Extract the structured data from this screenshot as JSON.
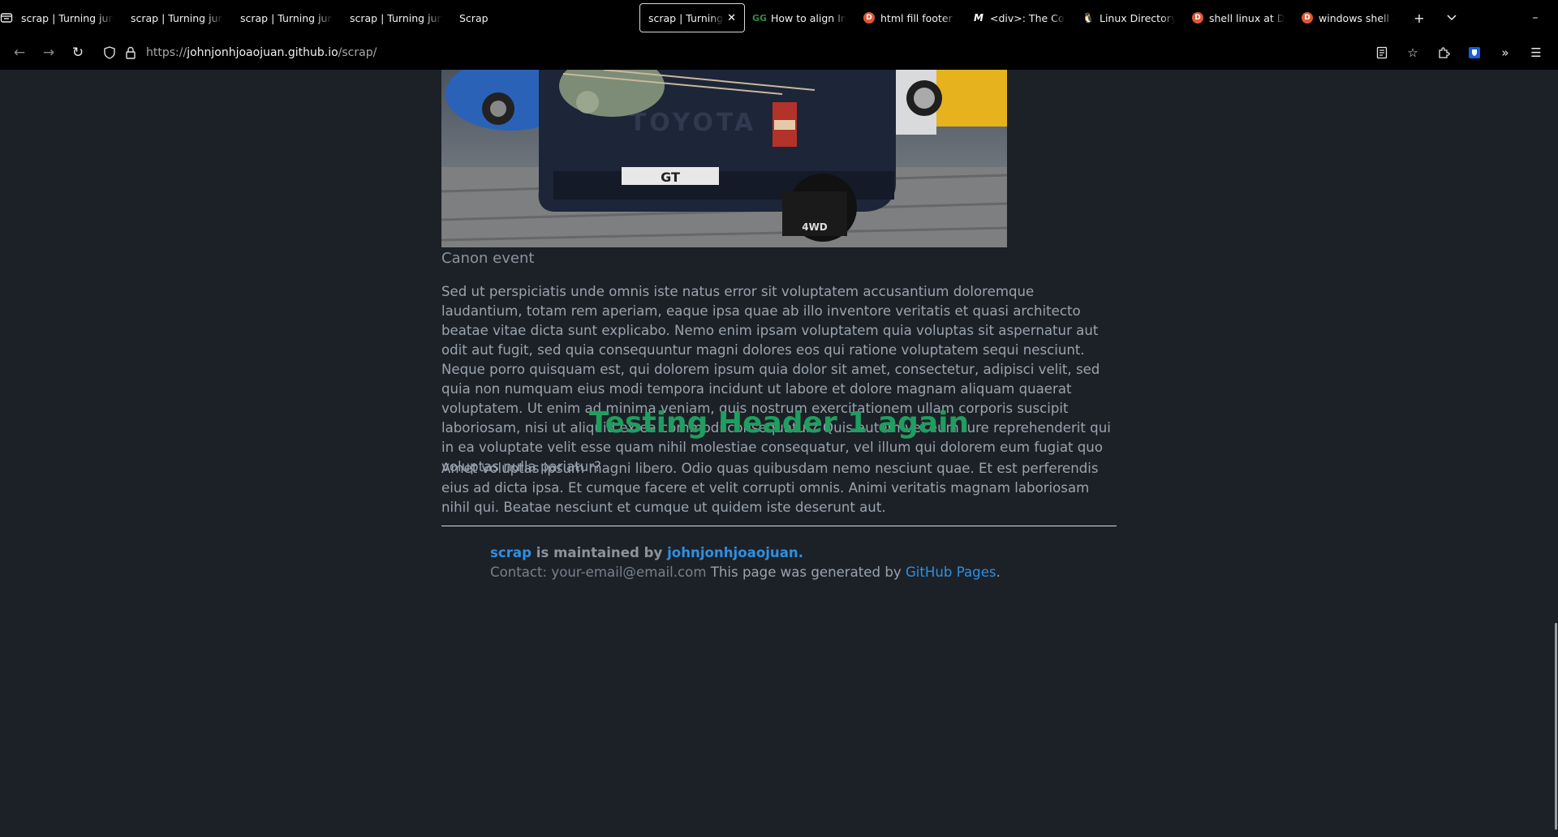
{
  "browser": {
    "tabs": [
      {
        "label": "scrap | Turning junk into art",
        "favicon": "none"
      },
      {
        "label": "scrap | Turning junk into art",
        "favicon": "none"
      },
      {
        "label": "scrap | Turning junk into art",
        "favicon": "none"
      },
      {
        "label": "scrap | Turning junk into art",
        "favicon": "none"
      },
      {
        "label": "Scrap",
        "favicon": "none"
      },
      {
        "label": "scrap | Turning junk into art",
        "favicon": "none",
        "active": true
      },
      {
        "label": "How to align Images",
        "favicon": "geeksforgeeks-icon"
      },
      {
        "label": "html fill footer at bottom",
        "favicon": "duckduckgo-icon"
      },
      {
        "label": "<div>: The Content Division",
        "favicon": "mdn-icon"
      },
      {
        "label": "Linux Directory Structure",
        "favicon": "linux-icon"
      },
      {
        "label": "shell linux at DuckDuckGo",
        "favicon": "duckduckgo-icon"
      },
      {
        "label": "windows shell at DuckDuckGo",
        "favicon": "duckduckgo-icon"
      }
    ],
    "url": {
      "scheme": "https://",
      "host": "johnjonhjoaojuan.github.io",
      "path": "/scrap/"
    }
  },
  "page": {
    "caption": "Canon event",
    "paragraph1": "Sed ut perspiciatis unde omnis iste natus error sit voluptatem accusantium doloremque laudantium, totam rem aperiam, eaque ipsa quae ab illo inventore veritatis et quasi architecto beatae vitae dicta sunt explicabo. Nemo enim ipsam voluptatem quia voluptas sit aspernatur aut odit aut fugit, sed quia consequuntur magni dolores eos qui ratione voluptatem sequi nesciunt. Neque porro quisquam est, qui dolorem ipsum quia dolor sit amet, consectetur, adipisci velit, sed quia non numquam eius modi tempora incidunt ut labore et dolore magnam aliquam quaerat voluptatem. Ut enim ad minima veniam, quis nostrum exercitationem ullam corporis suscipit laboriosam, nisi ut aliquid ex ea commodi consequatur? Quis autem vel eum iure reprehenderit qui in ea voluptate velit esse quam nihil molestiae consequatur, vel illum qui dolorem eum fugiat quo voluptas nulla pariatur?",
    "heading": "Testing Header 1 again",
    "paragraph2": "Amet voluptas ipsum magni libero. Odio quas quibusdam nemo nesciunt quae. Et est perferendis eius ad dicta ipsa. Et cumque facere et velit corrupti omnis. Animi veritatis magnam laboriosam nihil qui. Beatae nesciunt et cumque ut quidem iste deserunt aut.",
    "footer": {
      "site_link": "scrap",
      "maintained_text": " is maintained by ",
      "author_link": "johnjonhjoaojuan",
      "period": ".",
      "contact_text": "Contact: your-email@email.com",
      "generated_text": " This page was generated by ",
      "gh_pages_link": "GitHub Pages",
      "end": "."
    }
  },
  "colors": {
    "background": "#1c2128",
    "heading": "#1f9e5f",
    "link": "#2f8fe0",
    "text": "#9aa3ad"
  }
}
